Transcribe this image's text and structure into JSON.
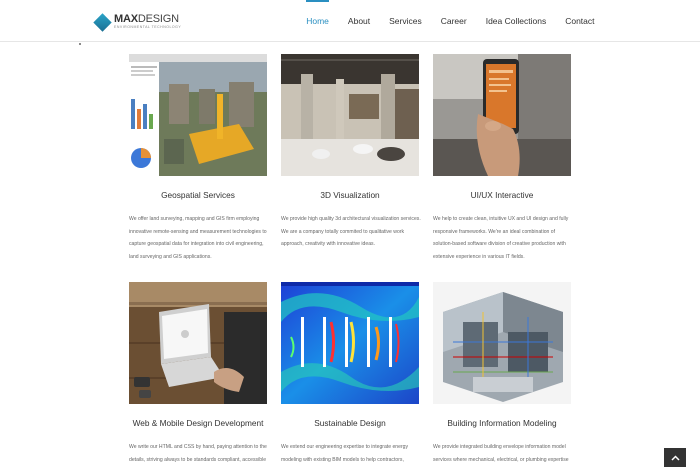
{
  "brand": {
    "name_bold": "MAX",
    "name_rest": "DESIGN",
    "tagline": "ENVIRONMENTAL TECHNOLOGY"
  },
  "nav": {
    "items": [
      "Home",
      "About",
      "Services",
      "Career",
      "Idea Collections",
      "Contact"
    ],
    "active": "Home"
  },
  "cards": [
    {
      "title": "Geospatial Services",
      "description": "We offer land surveying, mapping and GIS firm employing innovative remote-sensing and measurement technologies to capture geospatial data for integration into civil engineering, land surveying and GIS applications."
    },
    {
      "title": "3D Visualization",
      "description": "We provide high quality 3d architectural visualization services. We are a company totally commited to qualitative work approach, creativity with innovative ideas."
    },
    {
      "title": "UI/UX Interactive",
      "description": "We help to create clean, intuitive UX and UI design and fully responsive frameworks. We're an ideal combination of solution-based software division of creative production with extensive experience in various IT fields."
    },
    {
      "title": "Web & Mobile Design Development",
      "description": "We write our HTML and CSS by hand, paying attention to the details, striving always to be standards compliant, accessible and search engine friendly."
    },
    {
      "title": "Sustainable Design",
      "description": "We extend our engineering expertise to integrate energy modeling with existing BIM models to help contractors, owners and project teams to build sustainable"
    },
    {
      "title": "Building Information Modeling",
      "description": "We provide integrated building envelope information model services where mechanical, electrical, or plumbing expertise is needed."
    }
  ],
  "icons": {
    "scroll_top": "chevron-up-icon"
  },
  "colors": {
    "accent": "#2a8fc1"
  }
}
